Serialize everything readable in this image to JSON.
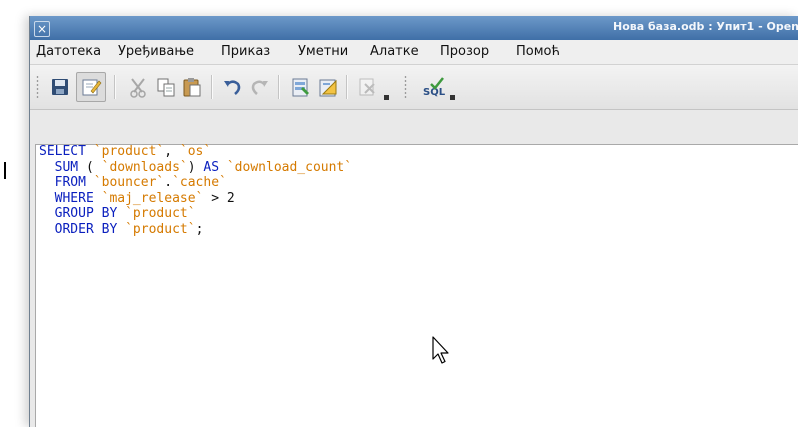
{
  "window": {
    "title": "Нова база.odb : Упит1 - Open"
  },
  "menu": [
    {
      "label": "Датотека"
    },
    {
      "label": "Уређивање"
    },
    {
      "label": "Приказ"
    },
    {
      "label": "Уметни"
    },
    {
      "label": "Алатке"
    },
    {
      "label": "Прозор"
    },
    {
      "label": "Помоћ"
    }
  ],
  "toolbar": {
    "buttons": [
      {
        "icon": "save-icon"
      },
      {
        "icon": "edit-mode-icon",
        "state": "pressed"
      },
      {
        "icon": "cut-icon",
        "state": "disabled"
      },
      {
        "icon": "copy-icon"
      },
      {
        "icon": "paste-icon"
      },
      {
        "icon": "undo-icon"
      },
      {
        "icon": "redo-icon",
        "state": "disabled"
      },
      {
        "icon": "run-query-icon"
      },
      {
        "icon": "design-view-icon"
      },
      {
        "icon": "clear-icon",
        "state": "disabled"
      },
      {
        "icon": "run-sql-directly-icon"
      }
    ]
  },
  "editor": {
    "lines": [
      [
        {
          "t": "kw",
          "v": "SELECT"
        },
        {
          "t": "plain",
          "v": " "
        },
        {
          "t": "id",
          "v": "`product`"
        },
        {
          "t": "plain",
          "v": ", "
        },
        {
          "t": "id",
          "v": "`os`"
        }
      ],
      [
        {
          "t": "plain",
          "v": "  "
        },
        {
          "t": "kw",
          "v": "SUM"
        },
        {
          "t": "plain",
          "v": " ( "
        },
        {
          "t": "id",
          "v": "`downloads`"
        },
        {
          "t": "plain",
          "v": ") "
        },
        {
          "t": "kw",
          "v": "AS"
        },
        {
          "t": "plain",
          "v": " "
        },
        {
          "t": "id",
          "v": "`download_count`"
        }
      ],
      [
        {
          "t": "plain",
          "v": "  "
        },
        {
          "t": "kw",
          "v": "FROM"
        },
        {
          "t": "plain",
          "v": " "
        },
        {
          "t": "id",
          "v": "`bouncer`"
        },
        {
          "t": "plain",
          "v": "."
        },
        {
          "t": "id",
          "v": "`cache`"
        }
      ],
      [
        {
          "t": "plain",
          "v": "  "
        },
        {
          "t": "kw",
          "v": "WHERE"
        },
        {
          "t": "plain",
          "v": " "
        },
        {
          "t": "id",
          "v": "`maj_release`"
        },
        {
          "t": "plain",
          "v": " > 2"
        }
      ],
      [
        {
          "t": "plain",
          "v": "  "
        },
        {
          "t": "kw",
          "v": "GROUP BY"
        },
        {
          "t": "plain",
          "v": " "
        },
        {
          "t": "id",
          "v": "`product`"
        }
      ],
      [
        {
          "t": "plain",
          "v": "  "
        },
        {
          "t": "kw",
          "v": "ORDER BY"
        },
        {
          "t": "plain",
          "v": " "
        },
        {
          "t": "id",
          "v": "`product`"
        },
        {
          "t": "plain",
          "v": ";"
        }
      ]
    ]
  },
  "colors": {
    "keyword": "#0a1fbe",
    "identifier": "#d57a00",
    "titlebar": "#4f7fb7"
  }
}
